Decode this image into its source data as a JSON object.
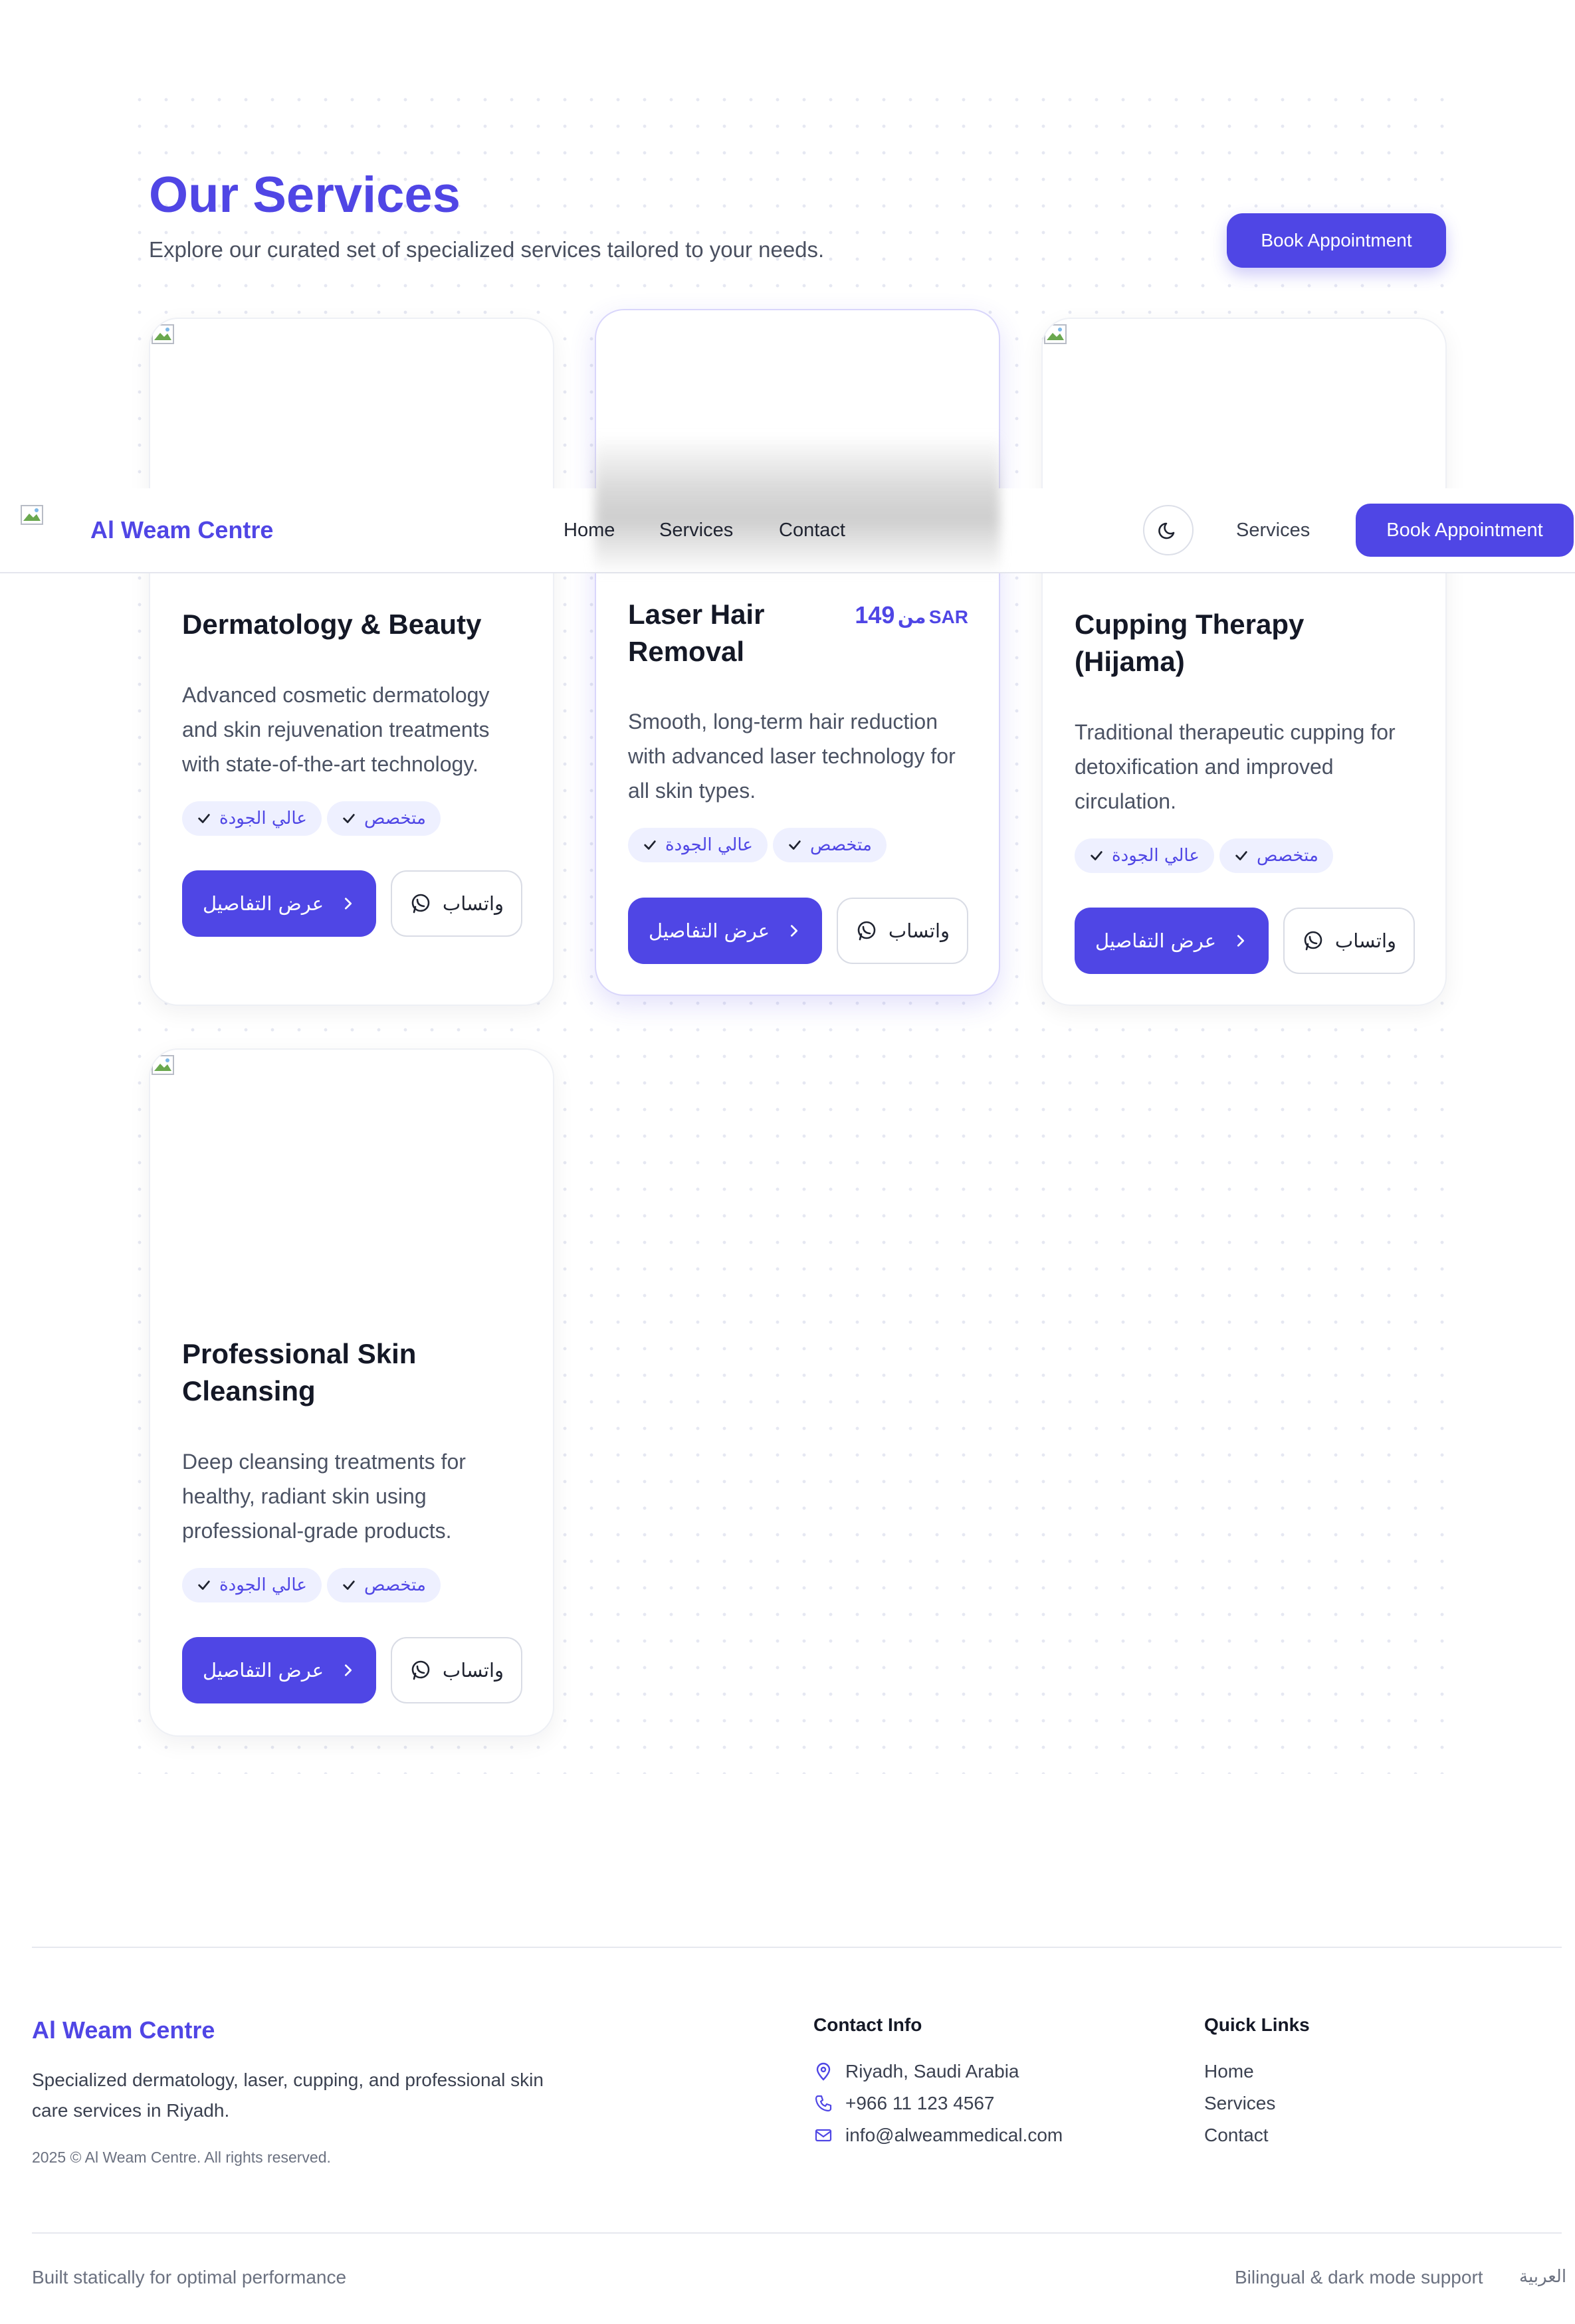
{
  "header": {
    "title": "Our Services",
    "subtitle": "Explore our curated set of specialized services tailored to your needs.",
    "book_label": "Book Appointment"
  },
  "navbar": {
    "brand": "Al Weam Centre",
    "links": [
      "Home",
      "Services",
      "Contact"
    ],
    "services_right": "Services",
    "book_label": "Book Appointment",
    "theme_icon": "moon-icon"
  },
  "services": [
    {
      "title": "Dermatology & Beauty",
      "description": "Advanced cosmetic dermatology and skin rejuvenation treatments with state-of-the-art technology.",
      "tags": [
        "عالي الجودة",
        "متخصص"
      ],
      "details_label": "عرض التفاصيل",
      "whatsapp_label": "واتساب"
    },
    {
      "title": "Laser Hair Removal",
      "description": "Smooth, long-term hair reduction with advanced laser technology for all skin types.",
      "price_prefix": "من",
      "price_amount": "149",
      "price_currency": "SAR",
      "tags": [
        "عالي الجودة",
        "متخصص"
      ],
      "details_label": "عرض التفاصيل",
      "whatsapp_label": "واتساب"
    },
    {
      "title": "Cupping Therapy (Hijama)",
      "description": "Traditional therapeutic cupping for detoxification and improved circulation.",
      "tags": [
        "عالي الجودة",
        "متخصص"
      ],
      "details_label": "عرض التفاصيل",
      "whatsapp_label": "واتساب"
    },
    {
      "title": "Professional Skin Cleansing",
      "description": "Deep cleansing treatments for healthy, radiant skin using professional-grade products.",
      "tags": [
        "عالي الجودة",
        "متخصص"
      ],
      "details_label": "عرض التفاصيل",
      "whatsapp_label": "واتساب"
    }
  ],
  "footer": {
    "brand": "Al Weam Centre",
    "description": "Specialized dermatology, laser, cupping, and professional skin care services in Riyadh.",
    "copyright": "2025 © Al Weam Centre. All rights reserved.",
    "contact_heading": "Contact Info",
    "contact": {
      "address": "Riyadh, Saudi Arabia",
      "phone": "+966 11 123 4567",
      "email": "info@alweammedical.com"
    },
    "quick_links_heading": "Quick Links",
    "quick_links": [
      "Home",
      "Services",
      "Contact"
    ],
    "bottom_left": "Built statically for optimal performance",
    "bottom_right": "Bilingual & dark mode support",
    "language_toggle": "العربية"
  },
  "colors": {
    "accent": "#4f46e5",
    "tag_bg": "#eef0ff",
    "text_dark": "#141826",
    "text_muted": "#4b5263"
  }
}
